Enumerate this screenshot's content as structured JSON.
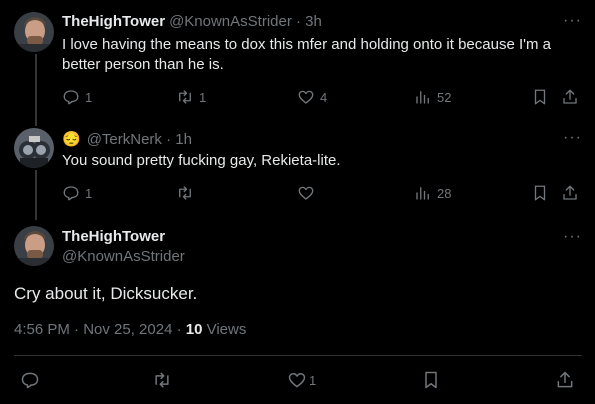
{
  "tweet1": {
    "display_name": "TheHighTower",
    "handle_time": "@KnownAsStrider · 3h",
    "text": "I love having the means to dox this mfer and holding onto it because I'm a better person than he is.",
    "replies": "1",
    "retweets": "1",
    "likes": "4",
    "views": "52"
  },
  "tweet2": {
    "emoji": "😔",
    "handle_time": "@TerkNerk · 1h",
    "text": "You sound pretty fucking gay, Rekieta-lite.",
    "replies": "1",
    "views": "28"
  },
  "main": {
    "display_name": "TheHighTower",
    "handle": "@KnownAsStrider",
    "text": "Cry about it, Dicksucker.",
    "timestamp": "4:56 PM · Nov 25, 2024 · ",
    "views_count": "10",
    "views_label": " Views",
    "likes": "1"
  },
  "more_glyph": "···",
  "icons": [
    "reply-icon",
    "retweet-icon",
    "like-icon",
    "views-icon",
    "bookmark-icon",
    "share-icon",
    "more-icon"
  ]
}
